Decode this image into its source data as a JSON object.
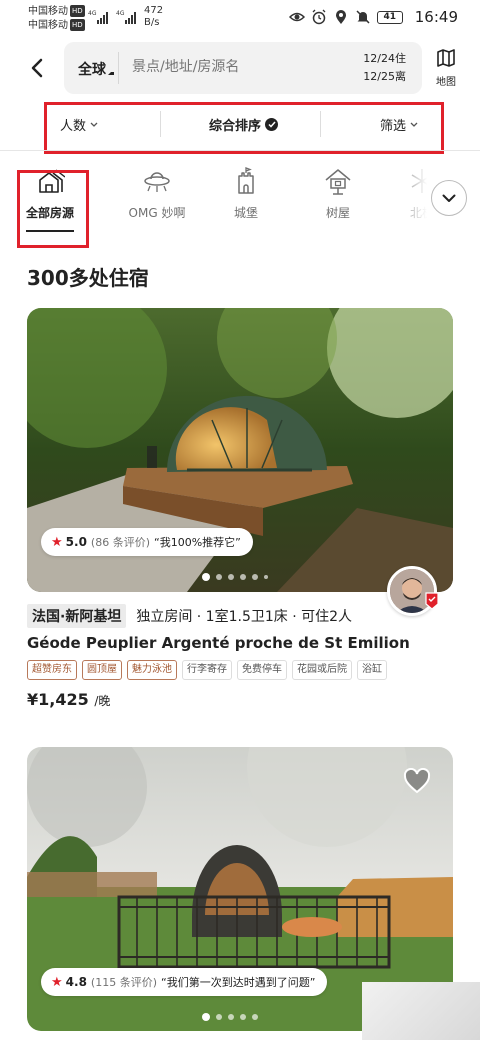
{
  "status_bar": {
    "carrier_1": "中国移动",
    "carrier_2": "中国移动",
    "hd_label": "HD",
    "signal_label_1": "4G",
    "signal_label_2": "4G",
    "net_speed_value": "472",
    "net_speed_unit": "B/s",
    "battery": "41",
    "time": "16:49"
  },
  "search": {
    "region": "全球",
    "placeholder": "景点/地址/房源名",
    "checkin": "12/24住",
    "checkout": "12/25离",
    "map_label": "地图"
  },
  "filters": {
    "people": "人数",
    "sort": "综合排序",
    "screen": "筛选"
  },
  "categories": [
    {
      "label": "全部房源",
      "icon": "homes-icon",
      "active": true
    },
    {
      "label": "OMG 妙啊",
      "icon": "ufo-icon",
      "active": false
    },
    {
      "label": "城堡",
      "icon": "castle-icon",
      "active": false
    },
    {
      "label": "树屋",
      "icon": "treehouse-icon",
      "active": false
    },
    {
      "label": "北极",
      "icon": "snowflake-icon",
      "active": false
    }
  ],
  "results_title": "300多处住宿",
  "listings": [
    {
      "rating": "5.0",
      "review_count": "(86 条评价)",
      "review_quote": "“我100%推荐它”",
      "location": "法国·新阿基坦",
      "details": "独立房间 · 1室1.5卫1床 · 可住2人",
      "title": "Géode Peuplier Argenté proche de St Emilion",
      "tags": [
        {
          "text": "超赞房东",
          "highlight": true
        },
        {
          "text": "圆顶屋",
          "highlight": true
        },
        {
          "text": "魅力泳池",
          "highlight": true
        },
        {
          "text": "行李寄存",
          "highlight": false
        },
        {
          "text": "免费停车",
          "highlight": false
        },
        {
          "text": "花园或后院",
          "highlight": false
        },
        {
          "text": "浴缸",
          "highlight": false
        }
      ],
      "price": "¥1,425",
      "price_unit": "/晚"
    },
    {
      "rating": "4.8",
      "review_count": "(115 条评价)",
      "review_quote": "“我们第一次到达时遇到了问题”"
    }
  ],
  "colors": {
    "annotation_red": "#e0212b",
    "star_red": "#e0212b",
    "tag_highlight": "#a35a34",
    "text_primary": "#222222",
    "text_secondary": "#717171"
  }
}
